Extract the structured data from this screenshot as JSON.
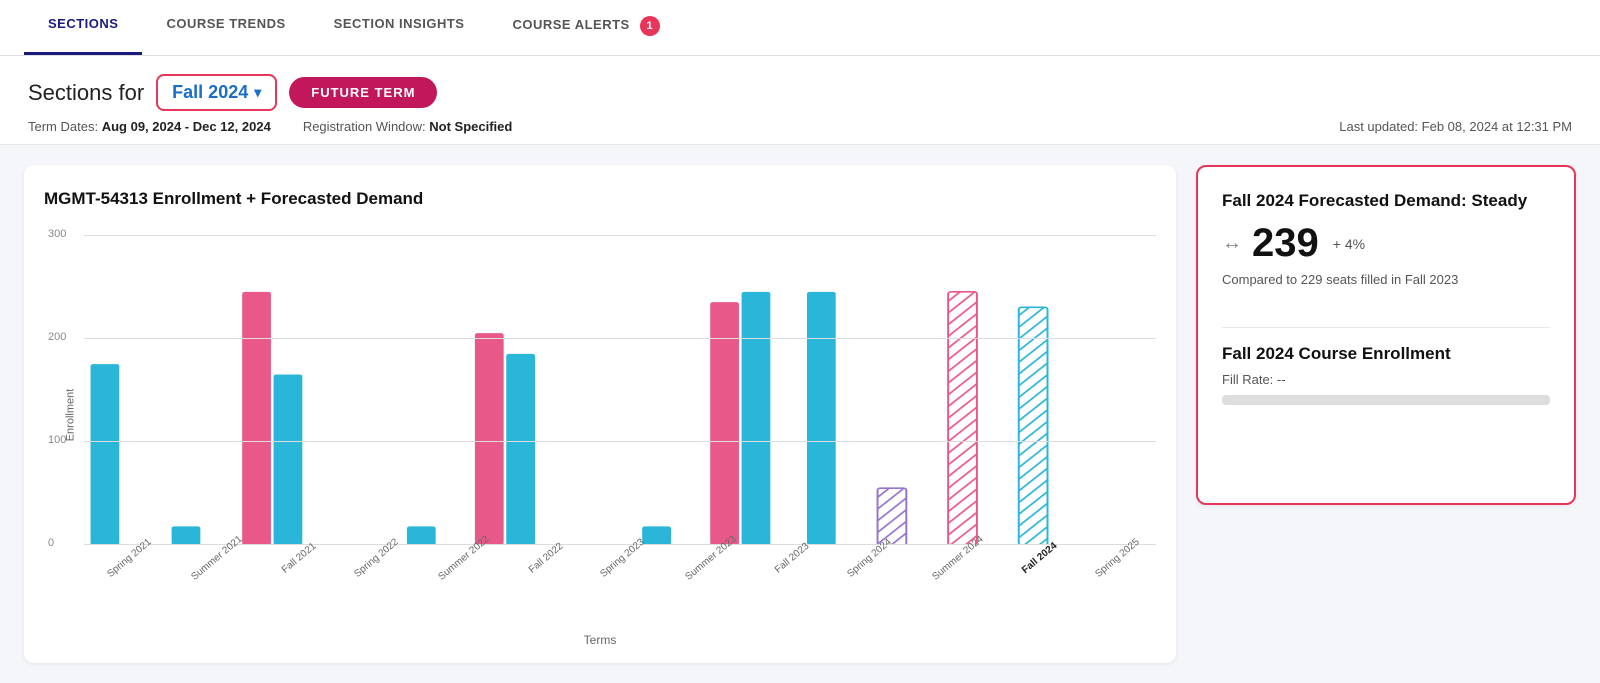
{
  "nav": {
    "tabs": [
      {
        "id": "sections",
        "label": "SECTIONS",
        "active": true,
        "badge": null
      },
      {
        "id": "course-trends",
        "label": "COURSE TRENDS",
        "active": false,
        "badge": null
      },
      {
        "id": "section-insights",
        "label": "SECTION INSIGHTS",
        "active": false,
        "badge": null
      },
      {
        "id": "course-alerts",
        "label": "COURSE ALERTS",
        "active": false,
        "badge": "1"
      }
    ]
  },
  "header": {
    "title_prefix": "Sections fo",
    "term": "Fall 2024",
    "future_term_label": "FUTURE TERM",
    "term_dates_label": "Term Dates:",
    "term_dates_value": "Aug 09, 2024 - Dec 12, 2024",
    "reg_window_label": "Registration Window:",
    "reg_window_value": "Not Specified",
    "last_updated_label": "Last updated:",
    "last_updated_value": "Feb 08, 2024 at 12:31 PM"
  },
  "chart": {
    "title": "MGMT-54313 Enrollment + Forecasted Demand",
    "y_axis_label": "Enrollment",
    "x_axis_label": "Terms",
    "y_max": 300,
    "y_labels": [
      "300",
      "200",
      "100",
      "0"
    ],
    "bars": [
      {
        "term": "Spring 2021",
        "blue": 175,
        "pink": null,
        "type": "solid"
      },
      {
        "term": "Summer 2021",
        "blue": 18,
        "pink": null,
        "type": "solid"
      },
      {
        "term": "Fall 2021",
        "blue": 165,
        "pink": 245,
        "type": "solid"
      },
      {
        "term": "Spring 2022",
        "blue": null,
        "pink": null,
        "type": "solid"
      },
      {
        "term": "Summer 2022",
        "blue": 18,
        "pink": null,
        "type": "solid"
      },
      {
        "term": "Fall 2022",
        "blue": 185,
        "pink": 205,
        "type": "solid"
      },
      {
        "term": "Spring 2023",
        "blue": null,
        "pink": null,
        "type": "solid"
      },
      {
        "term": "Summer 2023",
        "blue": 18,
        "pink": null,
        "type": "solid"
      },
      {
        "term": "Fall 2023",
        "blue": 245,
        "pink": 235,
        "type": "solid"
      },
      {
        "term": "Spring 2024",
        "blue": 245,
        "pink": null,
        "type": "solid"
      },
      {
        "term": "Summer 2024",
        "blue": null,
        "pink": null,
        "purple_hatch": 55,
        "type": "hatch"
      },
      {
        "term": "Fall 2024",
        "pink_hatch": 245,
        "blue_hatch": null,
        "type": "hatch",
        "bold": true
      },
      {
        "term": "Spring 2025",
        "blue_hatch": 230,
        "type": "hatch"
      }
    ]
  },
  "info_card": {
    "demand_title": "Fall 2024 Forecasted Demand: Steady",
    "demand_icon": "↔",
    "demand_number": "239",
    "demand_change": "+ 4%",
    "demand_sub": "Compared to 229 seats filled in Fall 2023",
    "enrollment_title": "Fall 2024 Course Enrollment",
    "fill_rate_label": "Fill Rate:",
    "fill_rate_value": "--",
    "fill_bar_percent": 0
  },
  "colors": {
    "accent_red": "#e8355a",
    "nav_active": "#1a1a7e",
    "pink_bar": "#e8598a",
    "blue_bar": "#29b6d8",
    "purple_bar": "#9575cd",
    "future_term_btn": "#c2185b"
  }
}
